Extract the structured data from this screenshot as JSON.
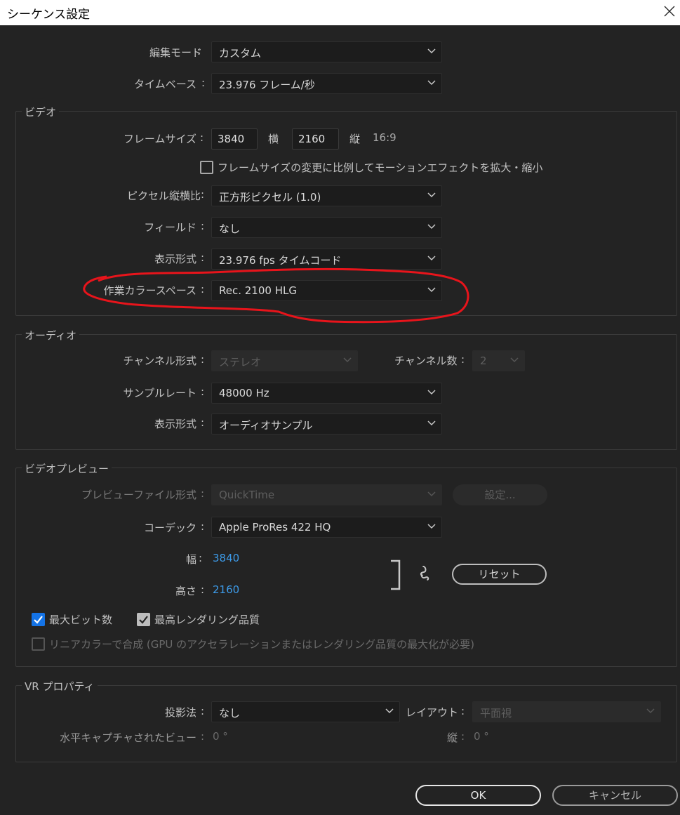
{
  "window": {
    "title": "シーケンス設定"
  },
  "general": {
    "edit_mode": {
      "label": "編集モード",
      "value": "カスタム"
    },
    "timebase": {
      "label": "タイムベース",
      "value": "23.976  フレーム/秒"
    }
  },
  "video": {
    "title": "ビデオ",
    "frame_size": {
      "label": "フレームサイズ",
      "width": "3840",
      "width_label": "横",
      "height": "2160",
      "height_label": "縦",
      "aspect": "16:9"
    },
    "scale_motion_checkbox": {
      "label": "フレームサイズの変更に比例してモーションエフェクトを拡大・縮小",
      "checked": false
    },
    "pixel_aspect": {
      "label": "ピクセル縦横比",
      "value": "正方形ピクセル (1.0)"
    },
    "fields": {
      "label": "フィールド",
      "value": "なし"
    },
    "display_format": {
      "label": "表示形式",
      "value": "23.976  fps タイムコード"
    },
    "working_color_space": {
      "label": "作業カラースペース",
      "value": "Rec. 2100 HLG"
    }
  },
  "audio": {
    "title": "オーディオ",
    "channel_format": {
      "label": "チャンネル形式",
      "value": "ステレオ"
    },
    "channel_count": {
      "label": "チャンネル数",
      "value": "2"
    },
    "sample_rate": {
      "label": "サンプルレート",
      "value": "48000 Hz"
    },
    "display_format": {
      "label": "表示形式",
      "value": "オーディオサンプル"
    }
  },
  "preview": {
    "title": "ビデオプレビュー",
    "file_format": {
      "label": "プレビューファイル形式",
      "value": "QuickTime"
    },
    "settings_button": "設定...",
    "codec": {
      "label": "コーデック",
      "value": "Apple ProRes 422 HQ"
    },
    "width": {
      "label": "幅",
      "value": "3840"
    },
    "height": {
      "label": "高さ",
      "value": "2160"
    },
    "reset_button": "リセット",
    "max_bit_depth": {
      "label": "最大ビット数",
      "checked": true
    },
    "max_render_quality": {
      "label": "最高レンダリング品質",
      "checked": true
    },
    "linear_color": {
      "label": "リニアカラーで合成 (GPU のアクセラレーションまたはレンダリング品質の最大化が必要)",
      "checked": false
    }
  },
  "vr": {
    "title": "VR プロパティ",
    "projection": {
      "label": "投影法",
      "value": "なし"
    },
    "layout": {
      "label": "レイアウト",
      "value": "平面視"
    },
    "h_captured_view": {
      "label": "水平キャプチャされたビュー",
      "value": "0 °"
    },
    "vertical": {
      "label": "縦",
      "value": "0 °"
    }
  },
  "footer": {
    "ok": "OK",
    "cancel": "キャンセル"
  },
  "annotation": {
    "color": "#e8141b"
  },
  "colors": {
    "accent_blue": "#1473e6",
    "link_blue": "#3d9be9"
  }
}
